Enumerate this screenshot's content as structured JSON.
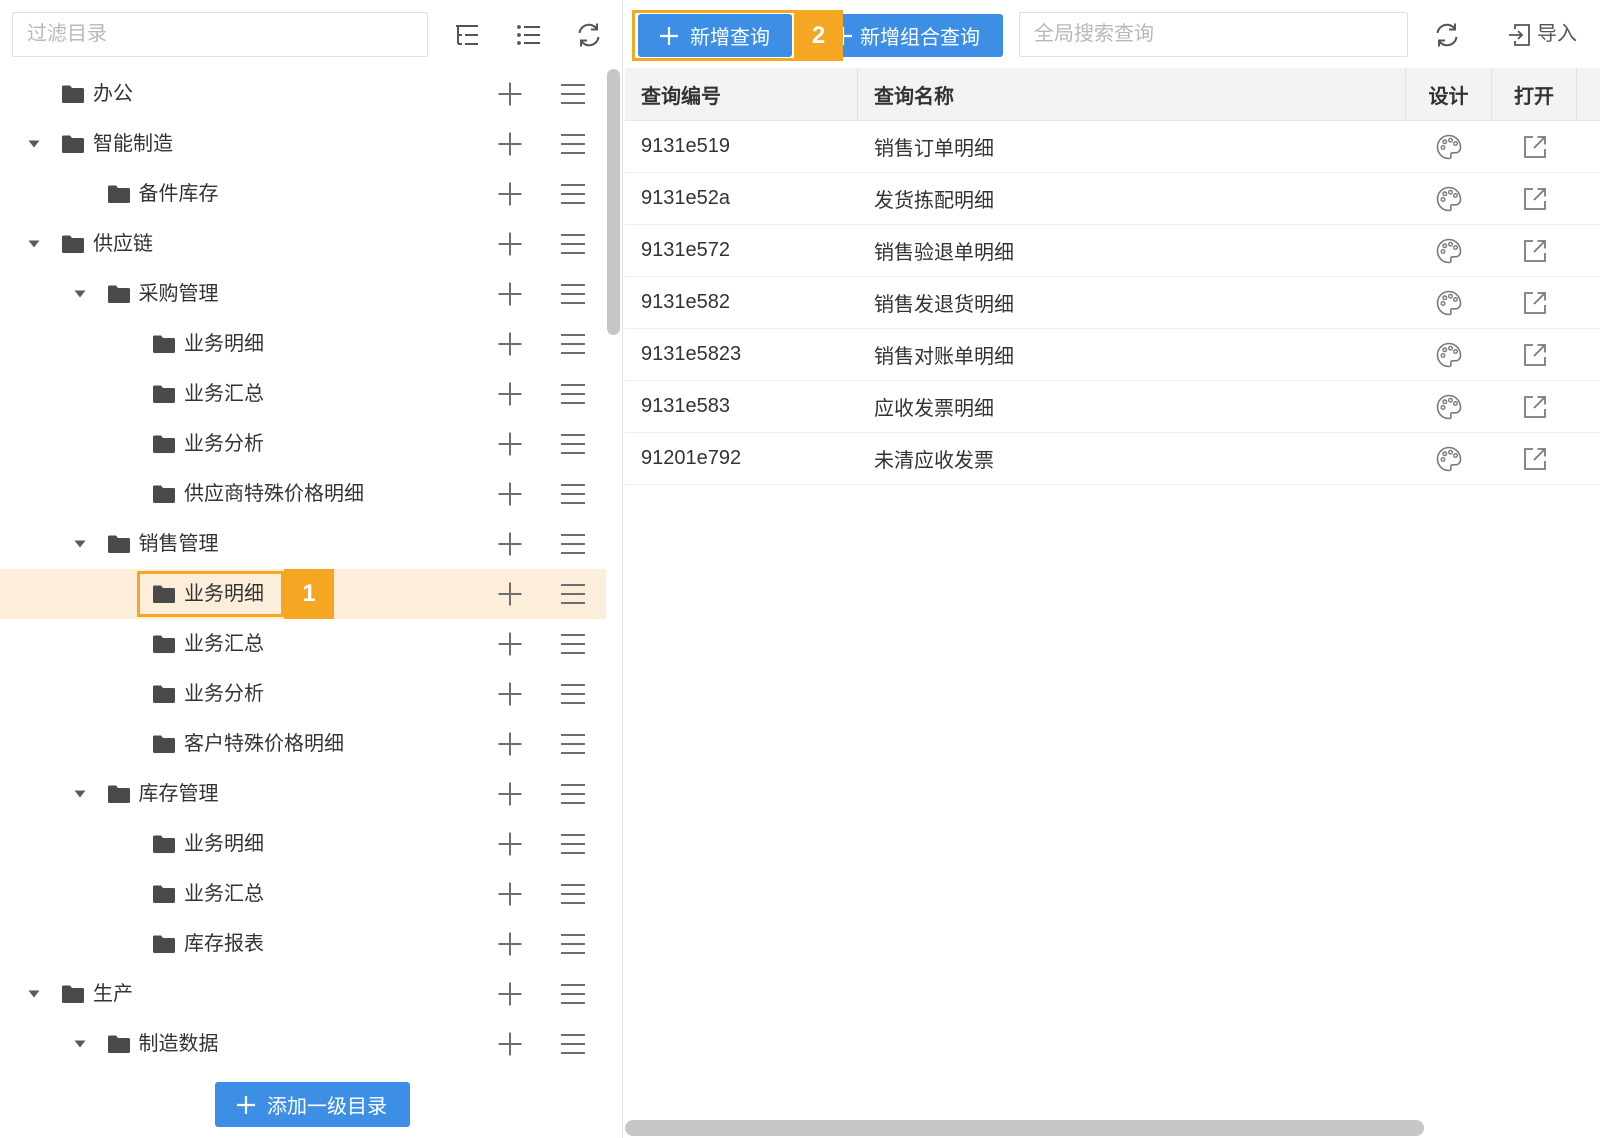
{
  "sidebar": {
    "filter_placeholder": "过滤目录",
    "toolbar_icons": {
      "tree": "tree-view-icon",
      "list": "list-view-icon",
      "refresh": "refresh-icon"
    },
    "node_icons": {
      "caret": "caret-down-icon",
      "folder": "folder-icon",
      "add": "plus-icon",
      "menu": "menu-icon"
    },
    "tree": [
      {
        "label": "办公"
      },
      {
        "label": "智能制造",
        "expanded": true,
        "children": [
          {
            "label": "备件库存"
          }
        ]
      },
      {
        "label": "供应链",
        "expanded": true,
        "children": [
          {
            "label": "采购管理",
            "expanded": true,
            "children": [
              {
                "label": "业务明细"
              },
              {
                "label": "业务汇总"
              },
              {
                "label": "业务分析"
              },
              {
                "label": "供应商特殊价格明细"
              }
            ]
          },
          {
            "label": "销售管理",
            "expanded": true,
            "children": [
              {
                "label": "业务明细",
                "selected": true
              },
              {
                "label": "业务汇总"
              },
              {
                "label": "业务分析"
              },
              {
                "label": "客户特殊价格明细"
              }
            ]
          },
          {
            "label": "库存管理",
            "expanded": true,
            "children": [
              {
                "label": "业务明细"
              },
              {
                "label": "业务汇总"
              },
              {
                "label": "库存报表"
              }
            ]
          }
        ]
      },
      {
        "label": "生产",
        "expanded": true,
        "children": [
          {
            "label": "制造数据",
            "expanded": true
          }
        ]
      }
    ],
    "add_root_label": "添加一级目录"
  },
  "toolbar": {
    "new_query_label": "新增查询",
    "new_combined_query_label": "新增组合查询",
    "search_placeholder": "全局搜索查询",
    "refresh_icon": "refresh-icon",
    "import_icon": "import-icon",
    "import_label": "导入"
  },
  "table": {
    "columns": [
      "查询编号",
      "查询名称",
      "设计",
      "打开"
    ],
    "row_icons": {
      "design": "palette-icon",
      "open": "external-link-icon"
    },
    "rows": [
      {
        "id": "9131e519",
        "name": "销售订单明细"
      },
      {
        "id": "9131e52a",
        "name": "发货拣配明细"
      },
      {
        "id": "9131e572",
        "name": "销售验退单明细"
      },
      {
        "id": "9131e582",
        "name": "销售发退货明细"
      },
      {
        "id": "9131e5823",
        "name": "销售对账单明细"
      },
      {
        "id": "9131e583",
        "name": "应收发票明细"
      },
      {
        "id": "91201e792",
        "name": "未清应收发票"
      }
    ]
  },
  "annotations": [
    "1",
    "2"
  ],
  "colors": {
    "primary": "#3d8fe6",
    "annotation": "#f5a623",
    "selected_row": "#fdeedb"
  }
}
